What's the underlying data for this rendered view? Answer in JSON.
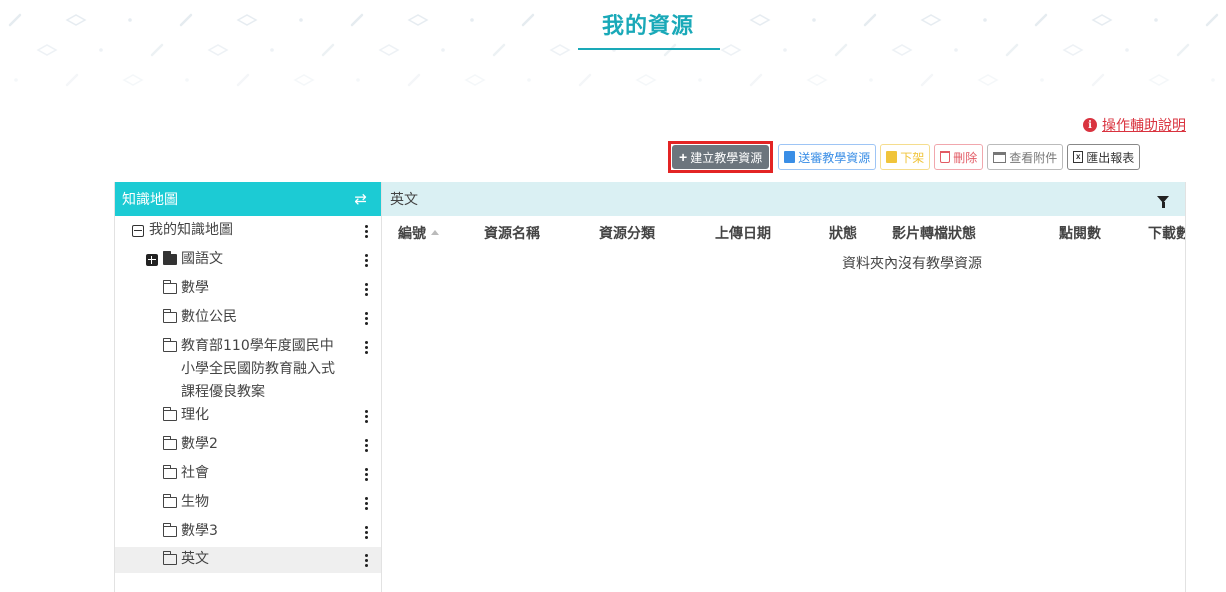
{
  "page": {
    "title": "我的資源"
  },
  "help": {
    "label": "操作輔助說明"
  },
  "toolbar": {
    "create": "建立教學資源",
    "submit": "送審教學資源",
    "unpublish": "下架",
    "delete": "刪除",
    "attachments": "查看附件",
    "export": "匯出報表"
  },
  "left": {
    "header": "知識地圖",
    "root": "我的知識地圖",
    "items": [
      {
        "label": "國語文"
      },
      {
        "label": "數學"
      },
      {
        "label": "數位公民"
      },
      {
        "label": "教育部110學年度國民中小學全民國防教育融入式課程優良教案"
      },
      {
        "label": "理化"
      },
      {
        "label": "數學2"
      },
      {
        "label": "社會"
      },
      {
        "label": "生物"
      },
      {
        "label": "數學3"
      },
      {
        "label": "英文"
      }
    ]
  },
  "right": {
    "folder": "英文",
    "columns": [
      "編號",
      "資源名稱",
      "資源分類",
      "上傳日期",
      "狀態",
      "影片轉檔狀態",
      "點閱數",
      "下載數"
    ],
    "empty": "資料夾內沒有教學資源"
  },
  "colors": {
    "accent": "#1aa9b8",
    "header": "#1ccbd4",
    "danger": "#d9333f"
  }
}
